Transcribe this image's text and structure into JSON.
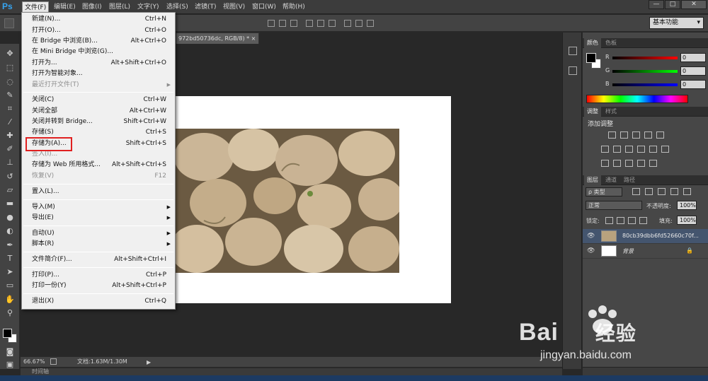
{
  "app": {
    "logo": "Ps"
  },
  "menubar": {
    "items": [
      "文件(F)",
      "编辑(E)",
      "图像(I)",
      "图层(L)",
      "文字(Y)",
      "选择(S)",
      "滤镜(T)",
      "视图(V)",
      "窗口(W)",
      "帮助(H)"
    ],
    "window_buttons": [
      "—",
      "□",
      "✕"
    ]
  },
  "options": {
    "workspace": "基本功能"
  },
  "document": {
    "tab_title": "972bd50736dc, RGB/8) * ×"
  },
  "file_menu": {
    "items": [
      {
        "label": "新建(N)...",
        "shortcut": "Ctrl+N"
      },
      {
        "label": "打开(O)...",
        "shortcut": "Ctrl+O"
      },
      {
        "label": "在 Bridge 中浏览(B)...",
        "shortcut": "Alt+Ctrl+O"
      },
      {
        "label": "在 Mini Bridge 中浏览(G)...",
        "shortcut": ""
      },
      {
        "label": "打开为...",
        "shortcut": "Alt+Shift+Ctrl+O"
      },
      {
        "label": "打开为智能对象...",
        "shortcut": ""
      },
      {
        "label": "最近打开文件(T)",
        "shortcut": ""
      },
      {
        "label": "关闭(C)",
        "shortcut": "Ctrl+W"
      },
      {
        "label": "关闭全部",
        "shortcut": "Alt+Ctrl+W"
      },
      {
        "label": "关闭并转到 Bridge...",
        "shortcut": "Shift+Ctrl+W"
      },
      {
        "label": "存储(S)",
        "shortcut": "Ctrl+S"
      },
      {
        "label": "存储为(A)...",
        "shortcut": "Shift+Ctrl+S"
      },
      {
        "label": "签入(I)...",
        "shortcut": ""
      },
      {
        "label": "存储为 Web 所用格式...",
        "shortcut": "Alt+Shift+Ctrl+S"
      },
      {
        "label": "恢复(V)",
        "shortcut": "F12"
      },
      {
        "label": "置入(L)...",
        "shortcut": ""
      },
      {
        "label": "导入(M)",
        "shortcut": ""
      },
      {
        "label": "导出(E)",
        "shortcut": ""
      },
      {
        "label": "自动(U)",
        "shortcut": ""
      },
      {
        "label": "脚本(R)",
        "shortcut": ""
      },
      {
        "label": "文件简介(F)...",
        "shortcut": "Alt+Shift+Ctrl+I"
      },
      {
        "label": "打印(P)...",
        "shortcut": "Ctrl+P"
      },
      {
        "label": "打印一份(Y)",
        "shortcut": "Alt+Shift+Ctrl+P"
      },
      {
        "label": "退出(X)",
        "shortcut": "Ctrl+Q"
      }
    ]
  },
  "status": {
    "zoom": "66.67%",
    "doc_size": "文档:1.63M/1.30M",
    "timeline": "时间轴"
  },
  "color_panel": {
    "tabs": [
      "颜色",
      "色板"
    ],
    "channels": [
      {
        "label": "R",
        "value": "0",
        "color": "#ff0000"
      },
      {
        "label": "G",
        "value": "0",
        "color": "#00ff00"
      },
      {
        "label": "B",
        "value": "0",
        "color": "#0000ff"
      }
    ]
  },
  "adjust_panel": {
    "tabs": [
      "调整",
      "样式"
    ],
    "title": "添加调整"
  },
  "layers_panel": {
    "tabs": [
      "图层",
      "通道",
      "路径"
    ],
    "filter": "ρ 类型",
    "blend_mode": "正常",
    "opacity_label": "不透明度:",
    "opacity": "100%",
    "lock_label": "锁定:",
    "fill_label": "填充:",
    "fill": "100%",
    "layers": [
      {
        "name": "80cb39dbb6fd52660c70f..."
      },
      {
        "name": "背景"
      }
    ]
  },
  "watermark": {
    "brand": "Bai",
    "brand_suffix": "经验",
    "url": "jingyan.baidu.com"
  }
}
